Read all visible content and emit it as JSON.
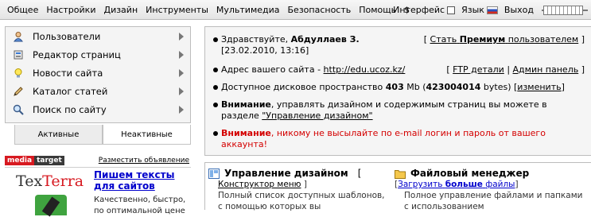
{
  "topmenu": [
    "Общее",
    "Настройки",
    "Дизайн",
    "Инструменты",
    "Мультимедиа",
    "Безопасность",
    "Помощь",
    "$"
  ],
  "topright": {
    "interface_label": "Интерфейс",
    "language_label": "Язык",
    "logout_label": "Выход"
  },
  "sidebar": {
    "items": [
      {
        "label": "Пользователи",
        "icon": "user-icon"
      },
      {
        "label": "Редактор страниц",
        "icon": "page-editor-icon"
      },
      {
        "label": "Новости сайта",
        "icon": "lightbulb-icon"
      },
      {
        "label": "Каталог статей",
        "icon": "pen-icon"
      },
      {
        "label": "Поиск по сайту",
        "icon": "search-icon"
      }
    ],
    "tabs": {
      "active": "Активные",
      "inactive": "Неактивные"
    }
  },
  "ad": {
    "logo_part1": "media",
    "logo_part2": "target",
    "place_link": "Разместить объявление",
    "brand_part1": "Tex",
    "brand_part2": "Terra",
    "title": "Пишем тексты для сайтов",
    "text": "Качественно, быстро, по оптимальной цене"
  },
  "info": {
    "greeting": "Здравствуйте,",
    "username": "Абдуллаев З.",
    "date": "[23.02.2010, 13:16]",
    "premium_prefix": "Стать",
    "premium_bold": "Премиум",
    "premium_suffix": "пользователем",
    "site_address_label": "Адрес вашего сайта -",
    "site_url": "http://edu.ucoz.kz/",
    "ftp_link": "FTP детали",
    "admin_link": "Админ панель",
    "disk_label": "Доступное дисковое пространство",
    "disk_mb": "403",
    "disk_unit": "Mb (",
    "disk_bytes": "423004014",
    "disk_bytes_unit": "bytes)",
    "change_link": "изменить",
    "attention1_bold": "Внимание",
    "attention1_text": ", управлять дизайном и содержимым страниц вы можете в разделе",
    "attention1_link": "\"Управление дизайном\"",
    "attention2_bold": "Внимание",
    "attention2_text": ", никому не высылайте по e-mail логин и пароль от вашего аккаунта!"
  },
  "sections": {
    "design_title": "Управление дизайном",
    "design_link": "Конструктор меню",
    "design_desc": "Полный список доступных шаблонов, с помощью которых вы",
    "files_title": "Файловый менеджер",
    "files_link_prefix": "Загрузить",
    "files_link_bold": "больше",
    "files_link_suffix": "файлы",
    "files_desc": "Полное управление файлами и папками с использованием"
  }
}
